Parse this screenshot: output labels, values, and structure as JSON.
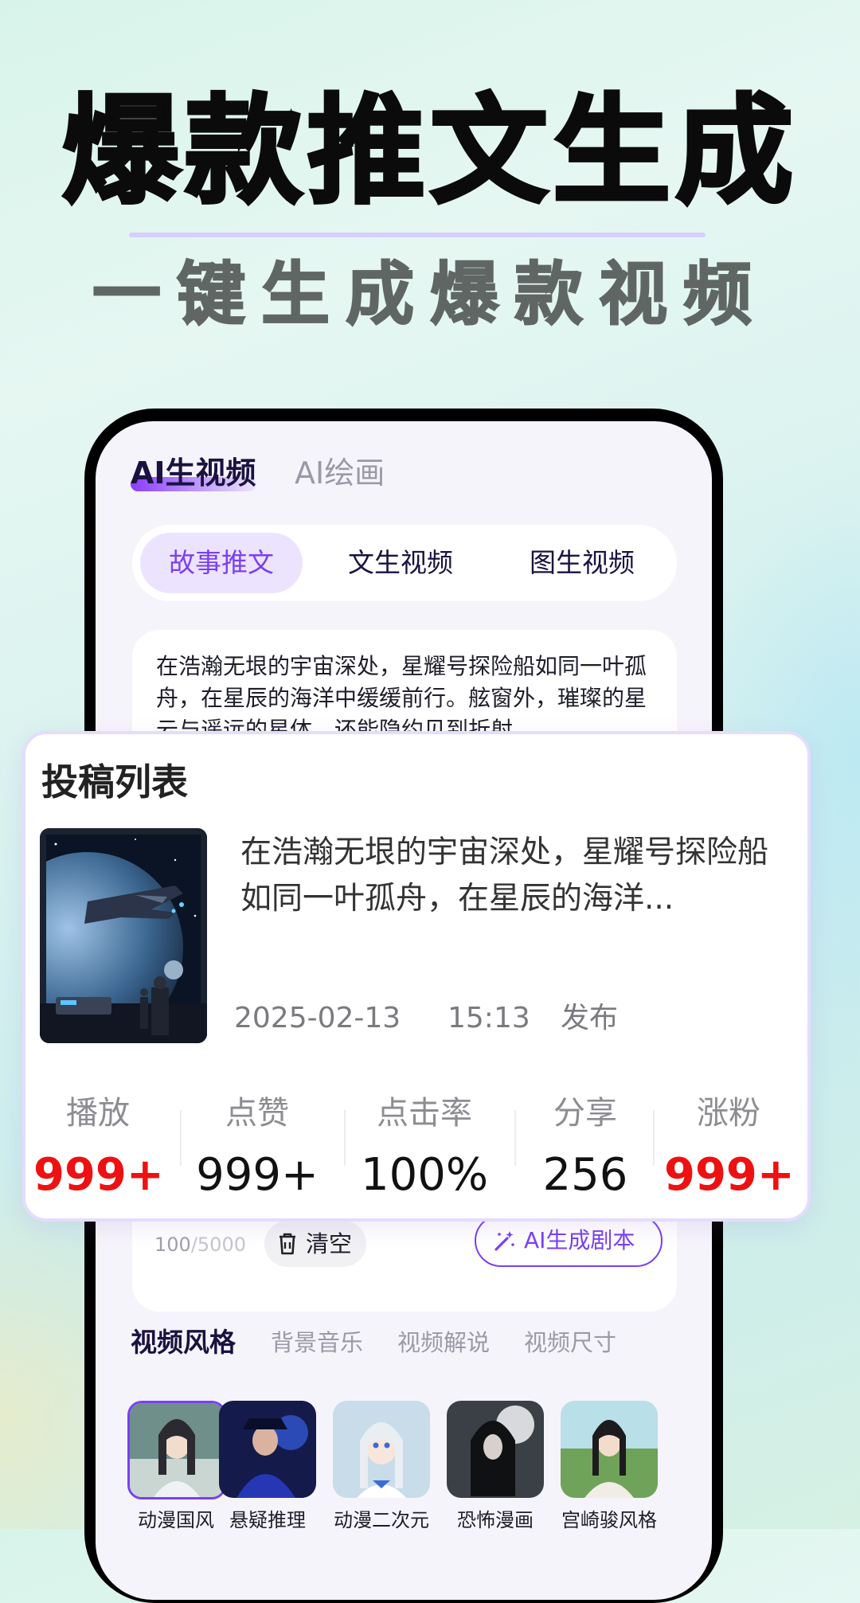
{
  "hero": {
    "title": "爆款推文生成",
    "subtitle": "一键生成爆款视频"
  },
  "top_tabs": [
    {
      "label": "AI生视频",
      "active": true
    },
    {
      "label": "AI绘画",
      "active": false
    }
  ],
  "segments": [
    {
      "label": "故事推文",
      "active": true
    },
    {
      "label": "文生视频",
      "active": false
    },
    {
      "label": "图生视频",
      "active": false
    }
  ],
  "story": {
    "text": "在浩瀚无垠的宇宙深处，星耀号探险船如同一叶孤舟，在星辰的海洋中缓缓前行。舷窗外，璀璨的星云与遥远的星体，还能隐约见到折射"
  },
  "editor": {
    "count": "100",
    "max": "/5000",
    "clear_label": "清空",
    "generate_label": "AI生成剧本"
  },
  "style_tabs": [
    {
      "label": "视频风格",
      "active": true
    },
    {
      "label": "背景音乐",
      "active": false
    },
    {
      "label": "视频解说",
      "active": false
    },
    {
      "label": "视频尺寸",
      "active": false
    }
  ],
  "styles": [
    {
      "label": "动漫国风",
      "selected": true
    },
    {
      "label": "悬疑推理",
      "selected": false
    },
    {
      "label": "动漫二次元",
      "selected": false
    },
    {
      "label": "恐怖漫画",
      "selected": false
    },
    {
      "label": "宫崎骏风格",
      "selected": false
    }
  ],
  "submissions": {
    "title": "投稿列表",
    "item": {
      "description": "在浩瀚无垠的宇宙深处，星耀号探险船如同一叶孤舟，在星辰的海洋...",
      "date": "2025-02-13",
      "time": "15:13",
      "status": "发布"
    },
    "stats": [
      {
        "label": "播放",
        "value": "999+",
        "highlight": true
      },
      {
        "label": "点赞",
        "value": "999+",
        "highlight": false
      },
      {
        "label": "点击率",
        "value": "100%",
        "highlight": false
      },
      {
        "label": "分享",
        "value": "256",
        "highlight": false
      },
      {
        "label": "涨粉",
        "value": "999+",
        "highlight": true
      }
    ]
  },
  "colors": {
    "accent": "#7a3ff5",
    "highlight_red": "#ee1111"
  }
}
